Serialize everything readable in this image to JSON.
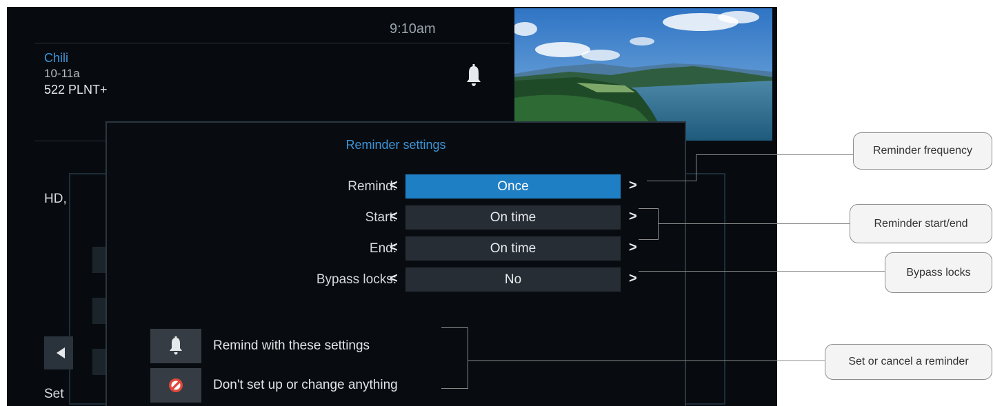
{
  "header": {
    "time": "9:10am"
  },
  "program": {
    "title": "Chili",
    "time_slot": "10-11a",
    "channel": "522 PLNT+",
    "bell_icon": "bell-icon"
  },
  "background_panel": {
    "text_fragment": "HD,",
    "footer_fragment": "Set"
  },
  "dialog": {
    "title": "Reminder settings",
    "rows": [
      {
        "label": "Remind:",
        "value": "Once"
      },
      {
        "label": "Start:",
        "value": "On time"
      },
      {
        "label": "End:",
        "value": "On time"
      },
      {
        "label": "Bypass locks:",
        "value": "No"
      }
    ],
    "arrow_left": "<",
    "arrow_right": ">",
    "actions": [
      {
        "label": "Remind with these settings",
        "icon": "bell-icon"
      },
      {
        "label": "Don't set up or change anything",
        "icon": "cancel-icon"
      }
    ]
  },
  "callouts": {
    "frequency": "Reminder frequency",
    "start_end": "Reminder start/end",
    "bypass": "Bypass locks",
    "set_cancel": "Set or cancel a reminder"
  },
  "colors": {
    "accent": "#3f95d9",
    "selected": "#1f7fc4",
    "screen_bg": "#070b0f",
    "cancel_red": "#e0473b"
  }
}
